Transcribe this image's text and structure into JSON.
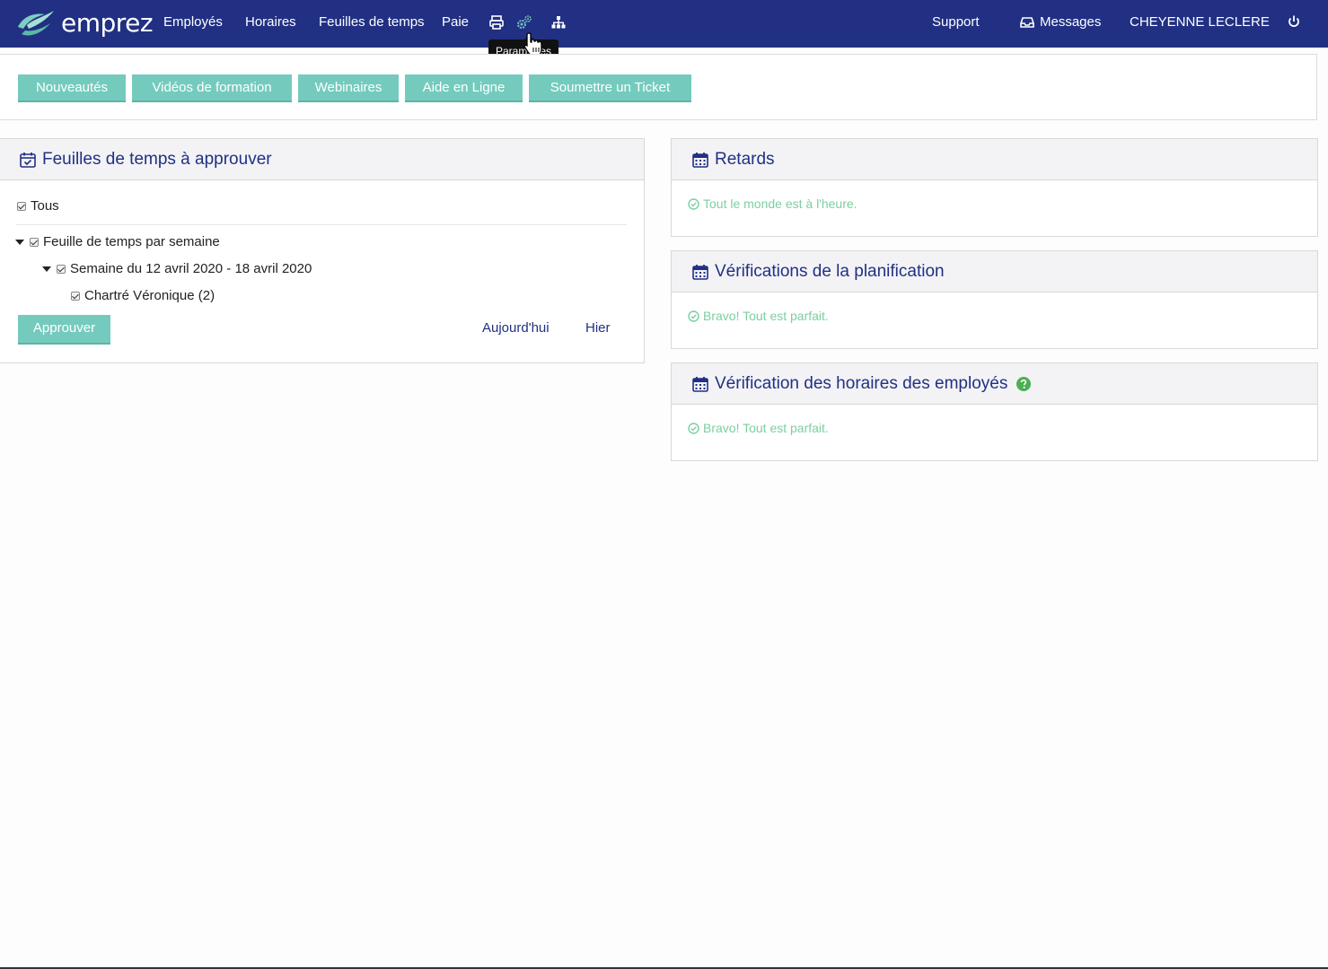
{
  "brand": {
    "name": "emprez"
  },
  "nav": {
    "items": [
      "Employés",
      "Horaires",
      "Feuilles de temps",
      "Paie"
    ],
    "icons": [
      "print-icon",
      "settings-icon",
      "org-chart-icon"
    ],
    "right": {
      "support": "Support",
      "messages": "Messages",
      "user": "CHEYENNE LECLERE"
    },
    "tooltip": "Paramètres"
  },
  "toolbar": {
    "buttons": [
      "Nouveautés",
      "Vidéos de formation",
      "Webinaires",
      "Aide en Ligne",
      "Soumettre un Ticket"
    ]
  },
  "timesheets": {
    "title": "Feuilles de temps à approuver",
    "all_label": "Tous",
    "group_label": "Feuille de temps par semaine",
    "week_label": "Semaine du 12 avril 2020 - 18 avril 2020",
    "employee_label": "Chartré Véronique (2)",
    "approve_label": "Approuver",
    "today_label": "Aujourd'hui",
    "yesterday_label": "Hier"
  },
  "retards": {
    "title": "Retards",
    "message": "Tout le monde est à l'heure."
  },
  "planification": {
    "title": "Vérifications de la planification",
    "message": "Bravo! Tout est parfait."
  },
  "horaires": {
    "title": "Vérification des horaires des employés",
    "message": "Bravo! Tout est parfait."
  },
  "colors": {
    "navbar": "#213083",
    "accent": "#74cbbd",
    "success": "#7ccfa0",
    "help": "#4caf50"
  }
}
